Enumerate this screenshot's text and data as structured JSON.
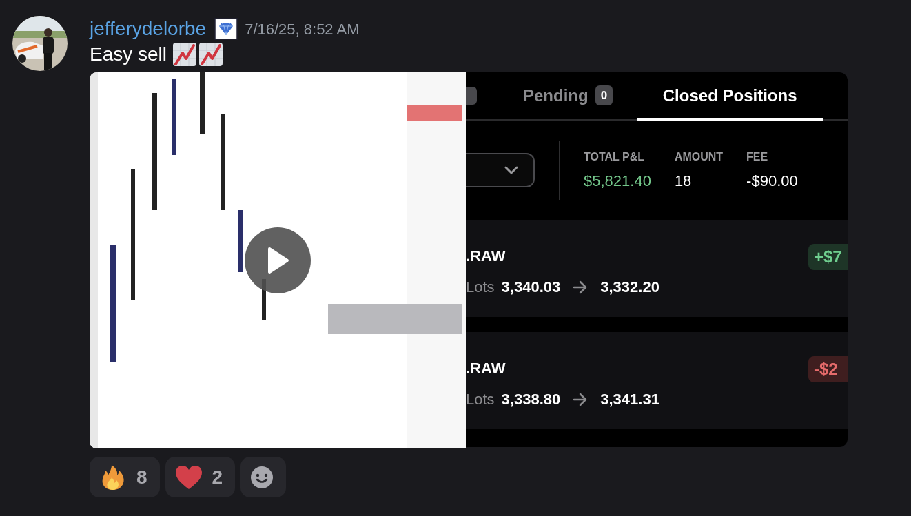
{
  "message": {
    "author": "jefferydelorbe",
    "timestamp": "7/16/25, 8:52 AM",
    "text": "Easy sell"
  },
  "screenshot": {
    "tabs": [
      {
        "label": "Pending",
        "count": "0",
        "selected": false
      },
      {
        "label": "Closed Positions",
        "selected": true
      }
    ],
    "stats": [
      {
        "label": "TOTAL P&L",
        "value": "$5,821.40",
        "color": "#74c78b"
      },
      {
        "label": "AMOUNT",
        "value": "18",
        "color": "#ffffff"
      },
      {
        "label": "FEE",
        "value": "-$90.00",
        "color": "#ffffff"
      }
    ],
    "positions": [
      {
        "symbol": ".RAW",
        "lots": "Lots",
        "entry": "3,340.03",
        "exit": "3,332.20",
        "pnl": "+$7",
        "kind": "profit"
      },
      {
        "symbol": ".RAW",
        "lots": "Lots",
        "entry": "3,338.80",
        "exit": "3,341.31",
        "pnl": "-$2",
        "kind": "loss"
      }
    ]
  },
  "reactions": [
    {
      "kind": "fire",
      "count": "8"
    },
    {
      "kind": "heart",
      "count": "2"
    },
    {
      "kind": "add"
    }
  ]
}
